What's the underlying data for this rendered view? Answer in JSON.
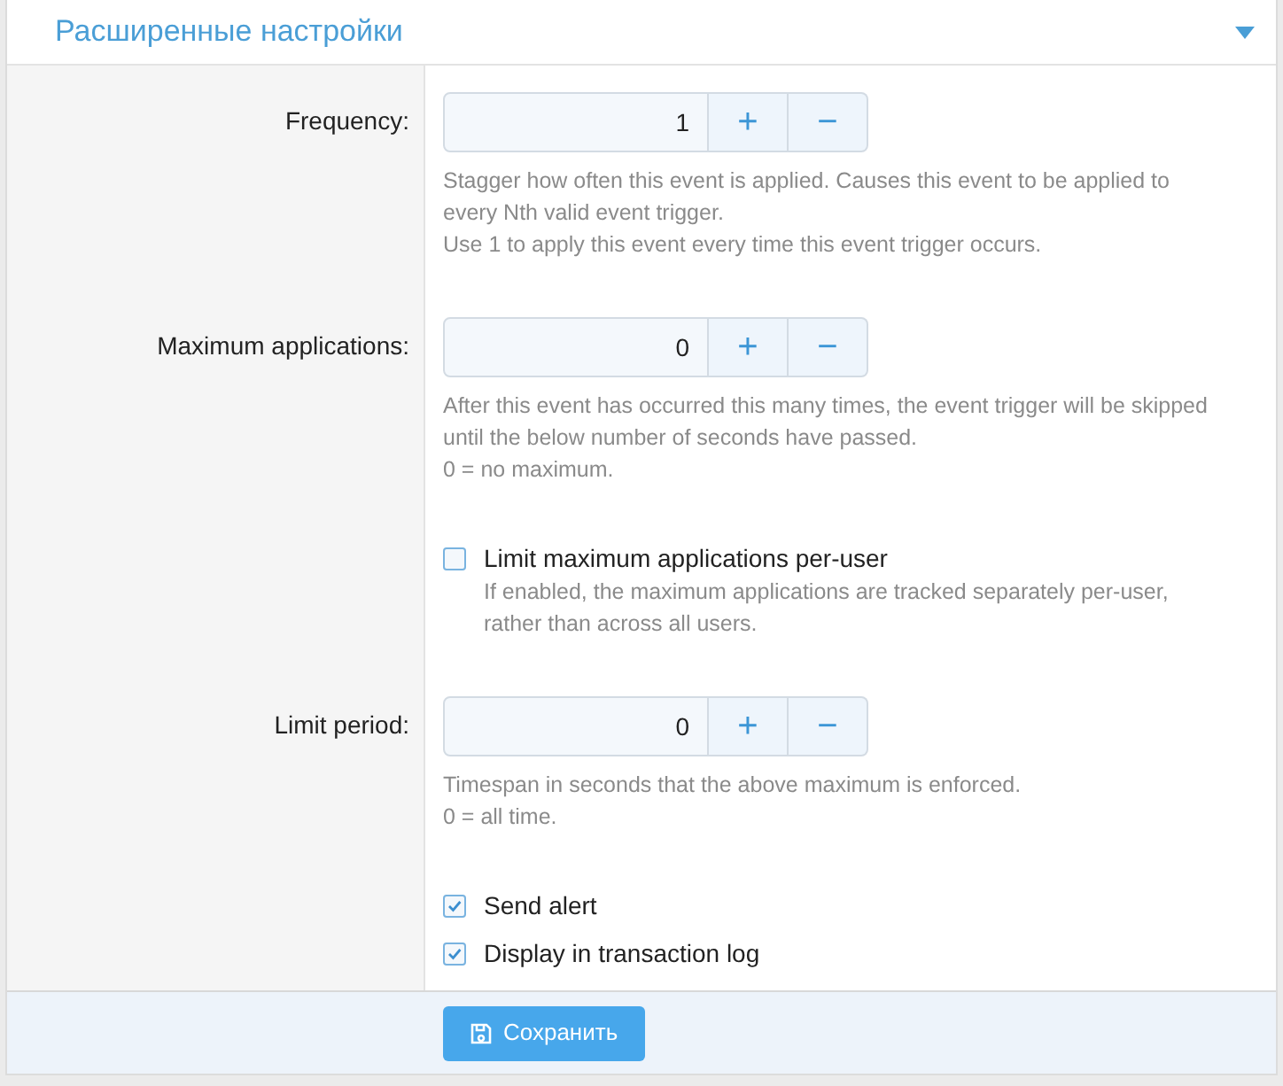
{
  "panel": {
    "title": "Расширенные настройки",
    "expanded": true
  },
  "rows": [
    {
      "kind": "number",
      "label": "Frequency:",
      "value": "1",
      "plus": "+",
      "minus": "−",
      "hints": [
        "Stagger how often this event is applied. Causes this event to be applied to every Nth valid event trigger.",
        "Use 1 to apply this event every time this event trigger occurs."
      ]
    },
    {
      "kind": "number",
      "label": "Maximum applications:",
      "value": "0",
      "plus": "+",
      "minus": "−",
      "hints": [
        "After this event has occurred this many times, the event trigger will be skipped until the below number of seconds have passed.",
        "0 = no maximum."
      ]
    },
    {
      "kind": "checkbox",
      "label": "Limit maximum applications per-user",
      "checked": false,
      "hint": "If enabled, the maximum applications are tracked separately per-user, rather than across all users."
    },
    {
      "kind": "number",
      "label": "Limit period:",
      "value": "0",
      "plus": "+",
      "minus": "−",
      "hints": [
        "Timespan in seconds that the above maximum is enforced.",
        "0 = all time."
      ]
    },
    {
      "kind": "checkbox",
      "label": "Send alert",
      "checked": true
    },
    {
      "kind": "checkbox",
      "label": "Display in transaction log",
      "checked": true
    }
  ],
  "save_button": {
    "label": "Сохранить"
  }
}
